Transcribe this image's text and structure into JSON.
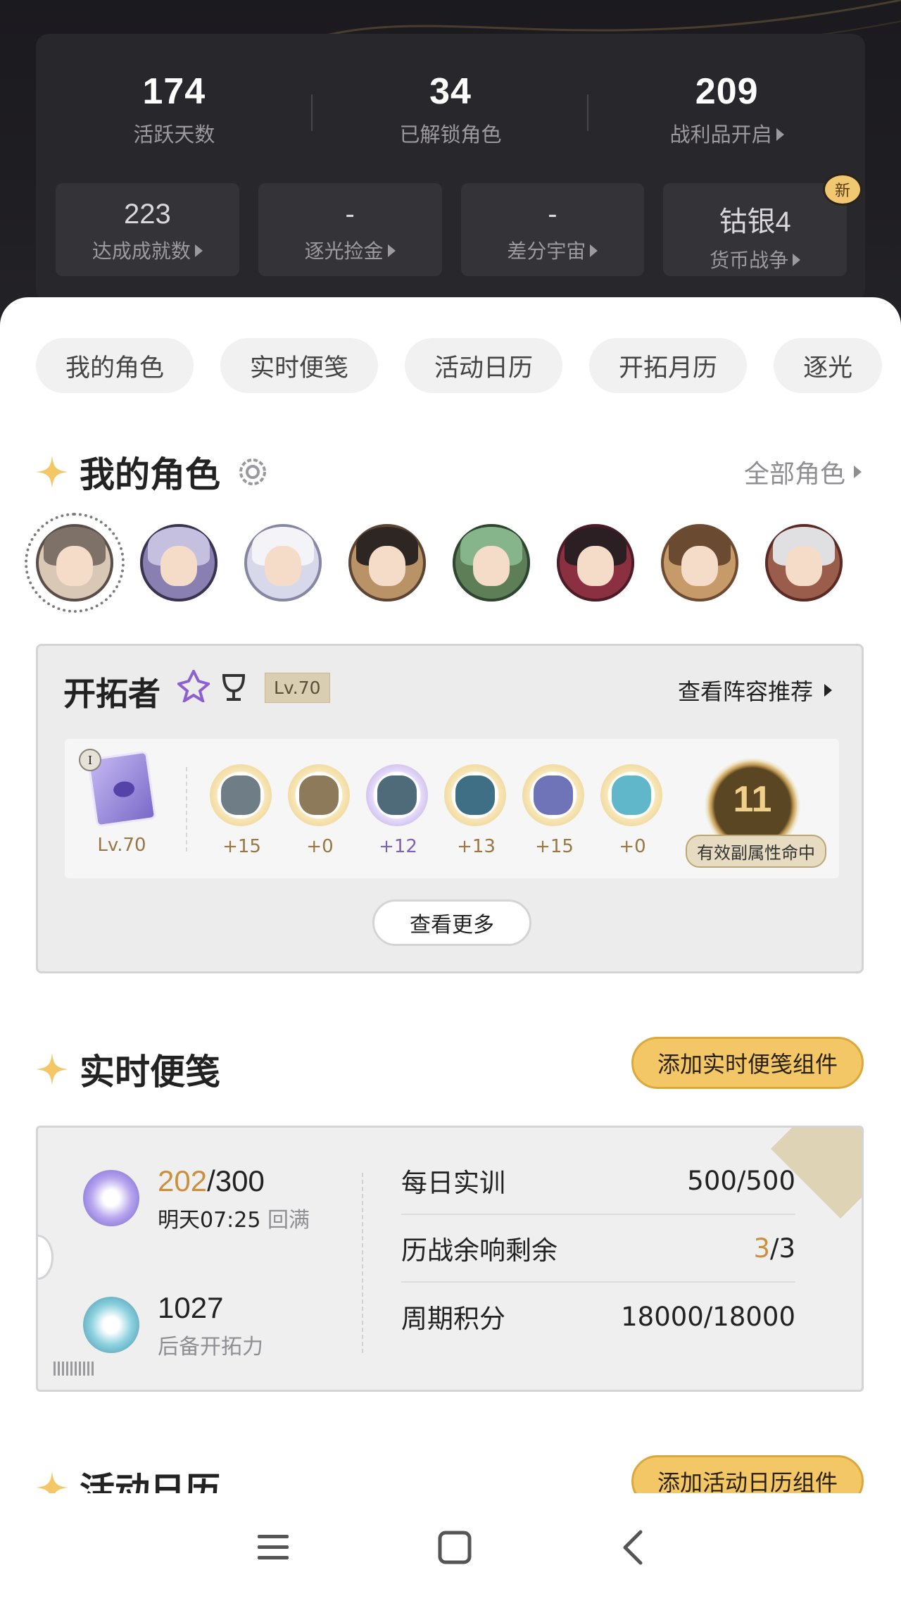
{
  "header": {
    "top_stats": [
      {
        "value": "174",
        "label": "活跃天数"
      },
      {
        "value": "34",
        "label": "已解锁角色"
      },
      {
        "value": "209",
        "label": "战利品开启"
      }
    ],
    "boxes": [
      {
        "value": "223",
        "label": "达成成就数"
      },
      {
        "value": "-",
        "label": "逐光捡金"
      },
      {
        "value": "-",
        "label": "差分宇宙"
      },
      {
        "value": "钴银4",
        "label": "货币战争",
        "badge": "新"
      }
    ]
  },
  "chips": [
    "我的角色",
    "实时便笺",
    "活动日历",
    "开拓月历",
    "逐光"
  ],
  "characters_section": {
    "title": "我的角色",
    "all_link": "全部角色",
    "avatars": [
      {
        "name": "avatar-1",
        "bg": "#d9c8b6",
        "hair": "#7d7168",
        "ring": "#5a4f48"
      },
      {
        "name": "avatar-2",
        "bg": "#8a7fb1",
        "hair": "#c5bfe0",
        "ring": "#3b3450"
      },
      {
        "name": "avatar-3",
        "bg": "#d7d9ea",
        "hair": "#f3f3f8",
        "ring": "#8587a3"
      },
      {
        "name": "avatar-4",
        "bg": "#b99266",
        "hair": "#2d2623",
        "ring": "#5d4536"
      },
      {
        "name": "avatar-5",
        "bg": "#5d7e57",
        "hair": "#87b58b",
        "ring": "#2e4530"
      },
      {
        "name": "avatar-6",
        "bg": "#8b3040",
        "hair": "#2c1f24",
        "ring": "#4c1c27"
      },
      {
        "name": "avatar-7",
        "bg": "#c79a6a",
        "hair": "#6a4a31",
        "ring": "#6c4d33"
      },
      {
        "name": "avatar-8",
        "bg": "#9a5d4c",
        "hair": "#e0e0e3",
        "ring": "#5a2c25"
      }
    ],
    "card": {
      "name": "开拓者",
      "level_tag": "Lv.70",
      "lineup_link": "查看阵容推荐",
      "light_cone": {
        "rank": "I",
        "level": "Lv.70"
      },
      "relics": [
        {
          "plus": "+15",
          "color": "#6e7d86",
          "rarity": "gold"
        },
        {
          "plus": "+0",
          "color": "#8c7a5a",
          "rarity": "gold"
        },
        {
          "plus": "+12",
          "color": "#4f6a78",
          "rarity": "purple"
        },
        {
          "plus": "+13",
          "color": "#3f6f84",
          "rarity": "gold"
        },
        {
          "plus": "+15",
          "color": "#6f74b9",
          "rarity": "gold"
        },
        {
          "plus": "+0",
          "color": "#5fb7c9",
          "rarity": "gold"
        }
      ],
      "hit_count": "11",
      "hit_label": "有效副属性命中",
      "see_more": "查看更多"
    }
  },
  "notes_section": {
    "title": "实时便笺",
    "add_button": "添加实时便笺组件",
    "power": {
      "current": "202",
      "max": "/300",
      "refill_time": "明天07:25",
      "refill_text": "回满"
    },
    "reserve": {
      "value": "1027",
      "label": "后备开拓力"
    },
    "rows": [
      {
        "label": "每日实训",
        "value_gold": "",
        "value": "500/500"
      },
      {
        "label": "历战余响剩余",
        "value_gold": "3",
        "value": "/3"
      },
      {
        "label": "周期积分",
        "value_gold": "",
        "value": "18000/18000"
      }
    ]
  },
  "calendar_section": {
    "title": "活动日历",
    "add_button": "添加活动日历组件"
  },
  "colors": {
    "accent_gold": "#f3c766",
    "text_gold": "#c9913e"
  }
}
